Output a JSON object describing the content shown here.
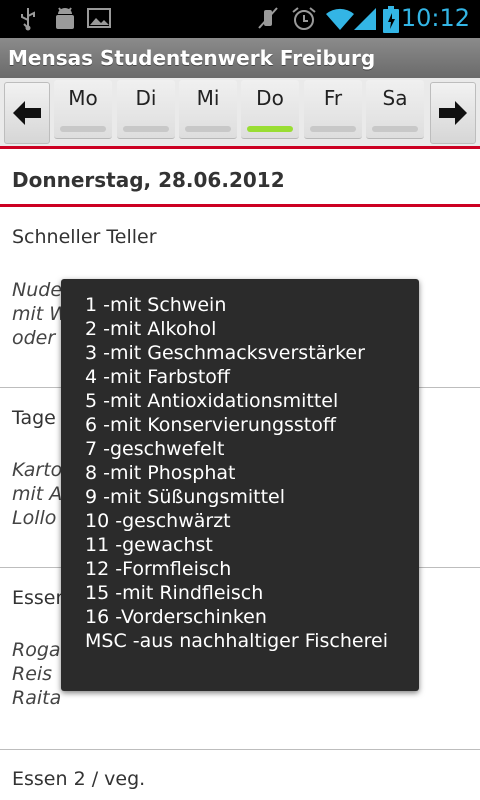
{
  "statusbar": {
    "time": "10:12",
    "icons": [
      "usb-icon",
      "android-debug-icon",
      "gallery-icon",
      "muted-icon",
      "alarm-icon",
      "wifi-icon",
      "signal-icon",
      "battery-icon"
    ]
  },
  "titlebar": {
    "title": "Mensas Studentenwerk Freiburg"
  },
  "daybar": {
    "days": [
      {
        "label": "Mo",
        "active": false
      },
      {
        "label": "Di",
        "active": false
      },
      {
        "label": "Mi",
        "active": false
      },
      {
        "label": "Do",
        "active": true
      },
      {
        "label": "Fr",
        "active": false
      },
      {
        "label": "Sa",
        "active": false
      }
    ],
    "active_color": "#99dd33"
  },
  "date_header": "Donnerstag, 28.06.2012",
  "menu": [
    {
      "name": "Schneller Teller",
      "lines": [
        "Nude",
        "mit W",
        "oder"
      ]
    },
    {
      "name": "Tage",
      "lines": [
        "Karto",
        "mit A",
        "Lollo"
      ]
    },
    {
      "name": "Essen",
      "lines": [
        "Roga",
        "Reis",
        "Raita"
      ]
    },
    {
      "name": "Essen 2 / veg.",
      "lines": []
    }
  ],
  "popup": {
    "items": [
      "1 -mit Schwein",
      "2 -mit Alkohol",
      "3 -mit Geschmacksverstärker",
      "4 -mit Farbstoff",
      "5 -mit Antioxidationsmittel",
      "6 -mit Konservierungsstoff",
      "7 -geschwefelt",
      "8 -mit Phosphat",
      "9 -mit Süßungsmittel",
      "10 -geschwärzt",
      "11 -gewachst",
      "12 -Formfleisch",
      "15 -mit Rindfleisch",
      "16 -Vorderschinken",
      "MSC -aus nachhaltiger Fischerei"
    ]
  },
  "colors": {
    "accent": "#cc0022",
    "status_time": "#33b5e5"
  }
}
